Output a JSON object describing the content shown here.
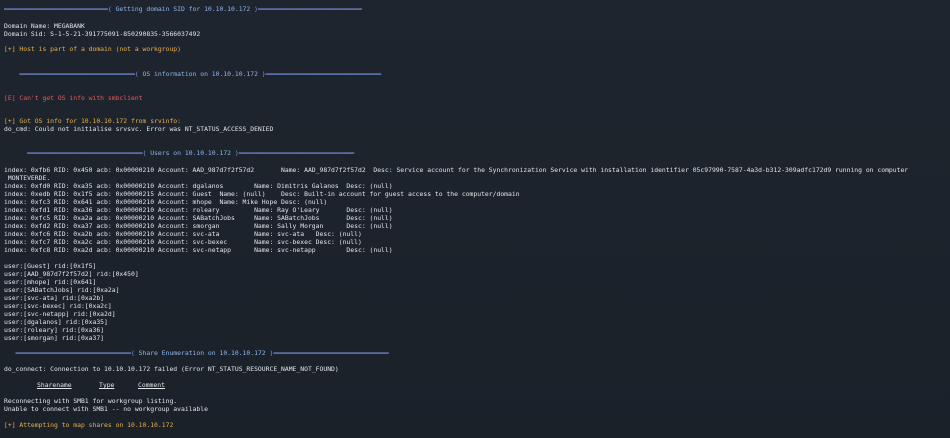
{
  "sections": {
    "domain_sid": "Getting domain SID for 10.10.10.172",
    "os_info": "OS information on 10.10.10.172",
    "users": "Users on 10.10.10.172",
    "shares": "Share Enumeration on 10.10.10.172"
  },
  "domain": {
    "name_line": "Domain Name: MEGABANK",
    "sid_line": "Domain Sid: S-1-5-21-391775091-850290835-3566037492",
    "host_line": "[+] Host is part of a domain (not a workgroup)"
  },
  "os": {
    "error_line": "[E] Can't get OS info with smbclient",
    "srvinfo_line": "[+] Got OS info for 10.10.10.172 from srvinfo:",
    "srvsvc_line": "do_cmd: Could not initialise srvsvc. Error was NT_STATUS_ACCESS_DENIED"
  },
  "users": {
    "index_lines": [
      "index: 0xfb6 RID: 0x450 acb: 0x00000210 Account: AAD_987d7f2f57d2       Name: AAD_987d7f2f57d2  Desc: Service account for the Synchronization Service with installation identifier 05c97990-7587-4a3d-b312-309adfc172d9 running on computer",
      " MONTEVERDE.",
      "index: 0xfd0 RID: 0xa35 acb: 0x00000210 Account: dgalanos        Name: Dimitris Galanos  Desc: (null)",
      "index: 0xedb RID: 0x1f5 acb: 0x00000215 Account: Guest  Name: (null)    Desc: Built-in account for guest access to the computer/domain",
      "index: 0xfc3 RID: 0x641 acb: 0x00000210 Account: mhope  Name: Mike Hope Desc: (null)",
      "index: 0xfd1 RID: 0xa36 acb: 0x00000210 Account: roleary         Name: Ray O'Leary       Desc: (null)",
      "index: 0xfc5 RID: 0xa2a acb: 0x00000210 Account: SABatchJobs     Name: SABatchJobs       Desc: (null)",
      "index: 0xfd2 RID: 0xa37 acb: 0x00000210 Account: smorgan         Name: Sally Morgan      Desc: (null)",
      "index: 0xfc6 RID: 0xa2b acb: 0x00000210 Account: svc-ata         Name: svc-ata   Desc: (null)",
      "index: 0xfc7 RID: 0xa2c acb: 0x00000210 Account: svc-bexec       Name: svc-bexec Desc: (null)",
      "index: 0xfc8 RID: 0xa2d acb: 0x00000210 Account: svc-netapp      Name: svc-netapp        Desc: (null)"
    ],
    "rid_lines": [
      "user:[Guest] rid:[0x1f5]",
      "user:[AAD_987d7f2f57d2] rid:[0x450]",
      "user:[mhope] rid:[0x641]",
      "user:[SABatchJobs] rid:[0xa2a]",
      "user:[svc-ata] rid:[0xa2b]",
      "user:[svc-bexec] rid:[0xa2c]",
      "user:[svc-netapp] rid:[0xa2d]",
      "user:[dgalanos] rid:[0xa35]",
      "user:[roleary] rid:[0xa36]",
      "user:[smorgan] rid:[0xa37]"
    ]
  },
  "shares": {
    "connect_line": "do_connect: Connection to 10.10.10.172 failed (Error NT_STATUS_RESOURCE_NAME_NOT_FOUND)",
    "col_sharename": "Sharename",
    "col_type": "Type",
    "col_comment": "Comment",
    "reconnect_line": "Reconnecting with SMB1 for workgroup listing.",
    "unable_line": "Unable to connect with SMB1 -- no workgroup available",
    "attempt_line": "[+] Attempting to map shares on 10.10.10.172"
  },
  "colors": {
    "background": "#1d232c",
    "header_rule": "#7d95e8",
    "success": "#e8b04f",
    "error": "#e35a5a",
    "info": "#4fc1d9"
  }
}
